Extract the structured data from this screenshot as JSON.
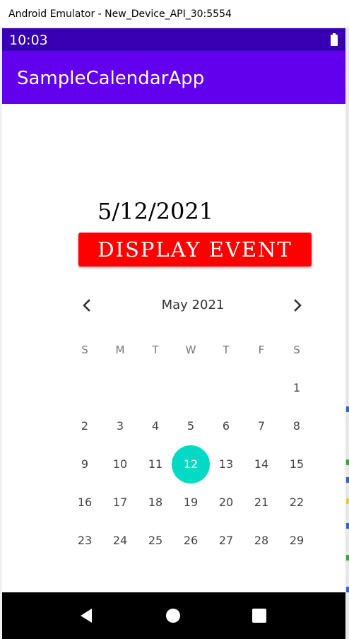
{
  "window": {
    "title": "Android Emulator - New_Device_API_30:5554"
  },
  "status_bar": {
    "time": "10:03",
    "battery_icon": "battery-full-icon"
  },
  "app_bar": {
    "title": "SampleCalendarApp"
  },
  "main": {
    "date_text": "5/12/2021",
    "display_button_label": "DISPLAY EVENT"
  },
  "calendar": {
    "month_label": "May 2021",
    "prev_icon": "chevron-left-icon",
    "next_icon": "chevron-right-icon",
    "weekdays": [
      "S",
      "M",
      "T",
      "W",
      "T",
      "F",
      "S"
    ],
    "weeks": [
      [
        "",
        "",
        "",
        "",
        "",
        "",
        "1"
      ],
      [
        "2",
        "3",
        "4",
        "5",
        "6",
        "7",
        "8"
      ],
      [
        "9",
        "10",
        "11",
        "12",
        "13",
        "14",
        "15"
      ],
      [
        "16",
        "17",
        "18",
        "19",
        "20",
        "21",
        "22"
      ],
      [
        "23",
        "24",
        "25",
        "26",
        "27",
        "28",
        "29"
      ]
    ],
    "selected_day": "12"
  },
  "nav_bar": {
    "back_icon": "back-triangle-icon",
    "home_icon": "home-circle-icon",
    "recents_icon": "recents-square-icon"
  },
  "colors": {
    "status_bar": "#3700b3",
    "app_bar": "#6200ee",
    "button": "#ff0000",
    "selected_day": "#03dac5"
  }
}
